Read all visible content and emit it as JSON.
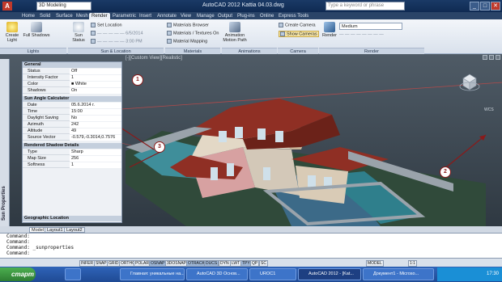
{
  "titlebar": {
    "app_logo": "A",
    "workspace": "3D Modeling",
    "title": "AutoCAD 2012   Kattia 04.03.dwg",
    "search_placeholder": "Type a keyword or phrase",
    "buttons": [
      "_",
      "□",
      "✕"
    ]
  },
  "tabs": [
    "Home",
    "Solid",
    "Surface",
    "Mesh",
    "Render",
    "Parametric",
    "Insert",
    "Annotate",
    "View",
    "Manage",
    "Output",
    "Plug-ins",
    "Online",
    "Express Tools"
  ],
  "active_tab": "Render",
  "ribbon": {
    "lights": {
      "create_light": "Create Light",
      "full_shadows": "Full Shadows",
      "panel": "Lights"
    },
    "sun": {
      "sun_status": "Sun Status",
      "set_location": "Set Location",
      "date": "6/5/2014",
      "time": "3:00 PM",
      "panel": "Sun & Location"
    },
    "materials": {
      "browser": "Materials Browser",
      "textures": "Materials / Textures On",
      "mapping": "Material Mapping",
      "panel": "Materials"
    },
    "animations": {
      "motion_path": "Animation Motion Path",
      "panel": "Animations"
    },
    "camera": {
      "create": "Create Camera",
      "show": "Show Cameras",
      "panel": "Camera"
    },
    "render": {
      "render_button": "Render",
      "preset": "Medium",
      "panel": "Render"
    }
  },
  "viewport": {
    "label": "[-][Custom View][Realistic]",
    "wcs": "WCS"
  },
  "palette": {
    "side_title": "Sun Properties",
    "sections": {
      "general": "General",
      "sun_angle": "Sun Angle Calculator",
      "rendered_shadow": "Rendered Shadow Details",
      "geo": "Geographic Location"
    },
    "general_rows": [
      {
        "k": "Status",
        "v": "Off"
      },
      {
        "k": "Intensity Factor",
        "v": "1"
      },
      {
        "k": "Color",
        "v": "■ White"
      },
      {
        "k": "Shadows",
        "v": "On"
      }
    ],
    "sun_rows": [
      {
        "k": "Date",
        "v": "05.6.2014 г."
      },
      {
        "k": "Time",
        "v": "15:00"
      },
      {
        "k": "Daylight Saving",
        "v": "No"
      },
      {
        "k": "Azimuth",
        "v": "242"
      },
      {
        "k": "Altitude",
        "v": "49"
      },
      {
        "k": "Source Vector",
        "v": "-0.579,-0.3014,0.7576"
      }
    ],
    "shadow_rows": [
      {
        "k": "Type",
        "v": "Sharp"
      },
      {
        "k": "Map Size",
        "v": "256"
      },
      {
        "k": "Softness",
        "v": "1"
      }
    ]
  },
  "callouts": [
    "1",
    "2",
    "3"
  ],
  "layout_tabs": [
    "Model",
    "Layout1",
    "Layout2"
  ],
  "command_lines": [
    "Command:",
    "Command:",
    "Command: _sunproperties",
    "Command:"
  ],
  "statusbar": {
    "coords": "",
    "buttons": [
      "INFER",
      "SNAP",
      "GRID",
      "ORTHO",
      "POLAR",
      "OSNAP",
      "3DOSNAP",
      "OTRACK",
      "DUCS",
      "DYN",
      "LWT",
      "TPY",
      "QP",
      "SC"
    ],
    "on_buttons": [
      "OSNAP",
      "OTRACK",
      "DUCS",
      "TPY"
    ],
    "model": "MODEL",
    "scale": "1:1"
  },
  "taskbar": {
    "start": "старт",
    "items": [
      "",
      "Главная: уникальные на...",
      "AutoCAD 3D Основ...",
      "UROC1",
      "AutoCAD 2012 - [Kat...",
      "Документ1 - Microso..."
    ],
    "active_index": 4,
    "clock": "17:30"
  }
}
